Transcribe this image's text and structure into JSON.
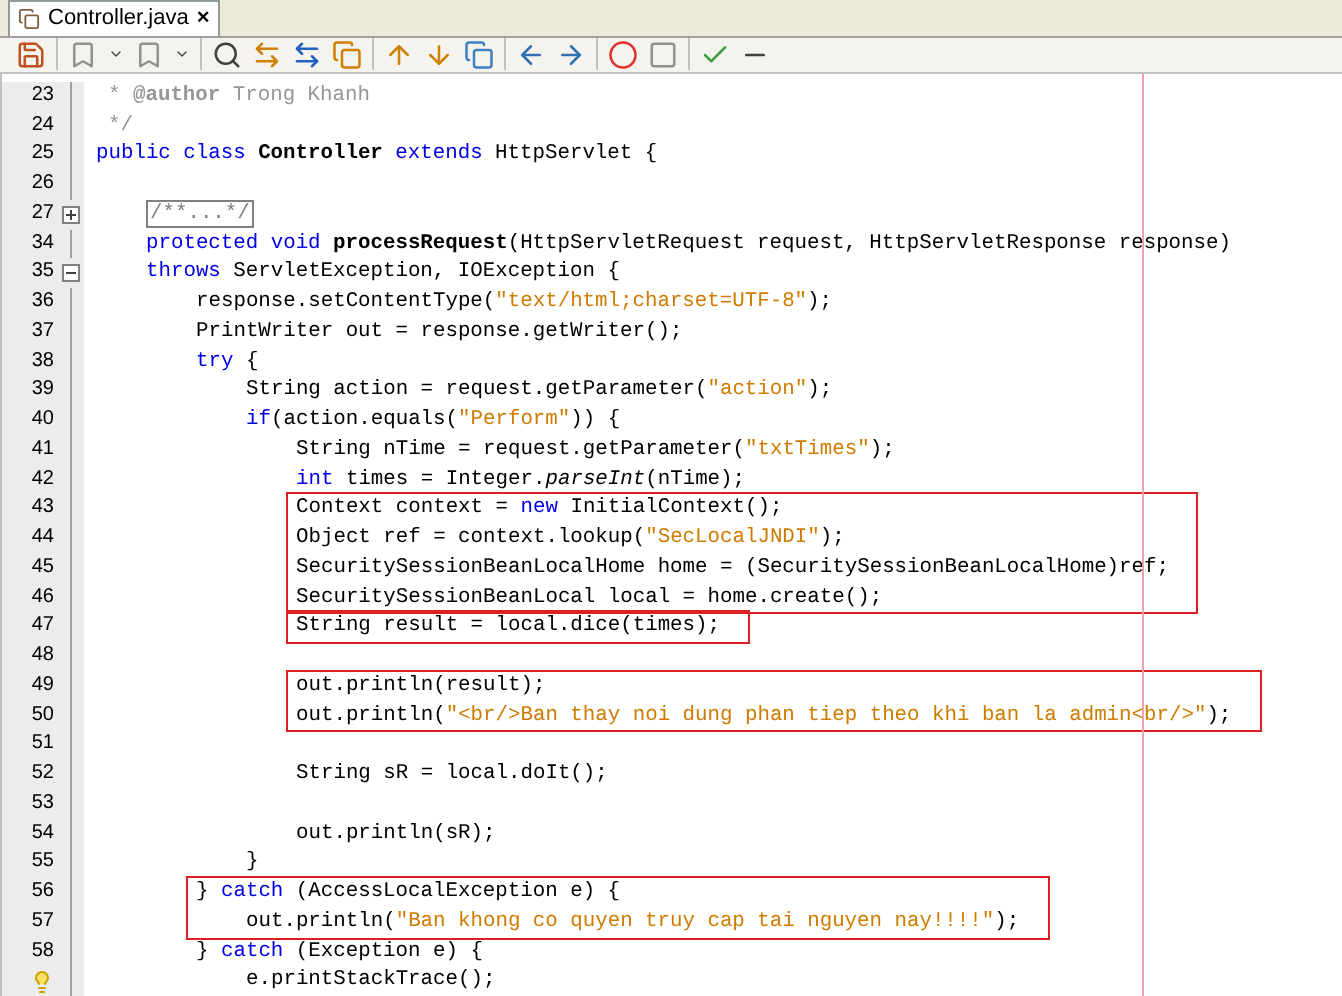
{
  "tab": {
    "label": "Controller.java",
    "close": "×",
    "selected": true
  },
  "code": [
    {
      "kind": "line",
      "number": "23",
      "tokens": [
        {
          "kind": "comment",
          "text": "* "
        },
        {
          "kind": "comment-tag",
          "text": "@author"
        },
        {
          "kind": "comment",
          "text": " Trong Khanh"
        }
      ]
    },
    {
      "kind": "line",
      "number": "24",
      "tokens": [
        {
          "kind": "comment",
          "text": "*/"
        }
      ]
    },
    {
      "kind": "line",
      "number": "25",
      "tokens": [
        {
          "kind": "keyword",
          "text": "public class "
        },
        {
          "kind": "bold",
          "text": "Controller"
        },
        {
          "kind": "keyword",
          "text": " extends "
        },
        {
          "kind": "plain",
          "text": "HttpServlet {"
        }
      ],
      "children": [
        {
          "kind": "blank",
          "number": "26"
        },
        {
          "kind": "line",
          "number": "27",
          "expanded": false,
          "tokens": [
            {
              "kind": "folded",
              "text": "/**...*/"
            }
          ]
        },
        {
          "kind": "line",
          "number": "34",
          "tokens": [
            {
              "kind": "keyword",
              "text": "protected void "
            },
            {
              "kind": "bold",
              "text": "processRequest"
            },
            {
              "kind": "plain",
              "text": "(HttpServletRequest request, HttpServletResponse response)"
            }
          ]
        },
        {
          "kind": "line",
          "number": "35",
          "expanded": true,
          "tokens": [
            {
              "kind": "keyword",
              "text": "throws "
            },
            {
              "kind": "plain",
              "text": "ServletException, IOException {"
            }
          ],
          "children": [
            {
              "kind": "line",
              "number": "36",
              "tokens": [
                {
                  "kind": "plain",
                  "text": "response.setContentType("
                },
                {
                  "kind": "string",
                  "text": "\"text/html;charset=UTF-8\""
                },
                {
                  "kind": "plain",
                  "text": ");"
                }
              ]
            },
            {
              "kind": "line",
              "number": "37",
              "tokens": [
                {
                  "kind": "plain",
                  "text": "PrintWriter out = response.getWriter();"
                }
              ]
            },
            {
              "kind": "line",
              "number": "38",
              "tokens": [
                {
                  "kind": "keyword",
                  "text": "try "
                },
                {
                  "kind": "plain",
                  "text": "{"
                }
              ],
              "children": [
                {
                  "kind": "line",
                  "number": "39",
                  "tokens": [
                    {
                      "kind": "plain",
                      "text": "String action = request.getParameter("
                    },
                    {
                      "kind": "string",
                      "text": "\"action\""
                    },
                    {
                      "kind": "plain",
                      "text": ");"
                    }
                  ]
                },
                {
                  "kind": "line",
                  "number": "40",
                  "tokens": [
                    {
                      "kind": "keyword",
                      "text": "if"
                    },
                    {
                      "kind": "plain",
                      "text": "(action.equals("
                    },
                    {
                      "kind": "string",
                      "text": "\"Perform\""
                    },
                    {
                      "kind": "plain",
                      "text": ")) {"
                    }
                  ],
                  "children": [
                    {
                      "kind": "line",
                      "number": "41",
                      "tokens": [
                        {
                          "kind": "plain",
                          "text": "String nTime = request.getParameter("
                        },
                        {
                          "kind": "string",
                          "text": "\"txtTimes\""
                        },
                        {
                          "kind": "plain",
                          "text": ");"
                        }
                      ]
                    },
                    {
                      "kind": "line",
                      "number": "42",
                      "tokens": [
                        {
                          "kind": "keyword",
                          "text": "int "
                        },
                        {
                          "kind": "plain",
                          "text": "times = Integer."
                        },
                        {
                          "kind": "italic",
                          "text": "parseInt"
                        },
                        {
                          "kind": "plain",
                          "text": "(nTime);"
                        }
                      ]
                    },
                    {
                      "kind": "box",
                      "lines": [
                        {
                          "kind": "line",
                          "number": "43",
                          "tokens": [
                            {
                              "kind": "plain",
                              "text": "Context context = "
                            },
                            {
                              "kind": "keyword",
                              "text": "new "
                            },
                            {
                              "kind": "plain",
                              "text": "InitialContext();"
                            }
                          ]
                        },
                        {
                          "kind": "line",
                          "number": "44",
                          "tokens": [
                            {
                              "kind": "plain",
                              "text": "Object ref = context.lookup("
                            },
                            {
                              "kind": "string",
                              "text": "\"SecLocalJNDI\""
                            },
                            {
                              "kind": "plain",
                              "text": ");"
                            }
                          ]
                        },
                        {
                          "kind": "line",
                          "number": "45",
                          "tokens": [
                            {
                              "kind": "plain",
                              "text": "SecuritySessionBeanLocalHome home = (SecuritySessionBeanLocalHome)ref;"
                            }
                          ]
                        },
                        {
                          "kind": "line",
                          "number": "46",
                          "tokens": [
                            {
                              "kind": "plain",
                              "text": "SecuritySessionBeanLocal local = home.create();"
                            }
                          ]
                        }
                      ]
                    },
                    {
                      "kind": "box",
                      "lines": [
                        {
                          "kind": "line",
                          "number": "47",
                          "tokens": [
                            {
                              "kind": "plain",
                              "text": "String result = local.dice(times);"
                            }
                          ]
                        }
                      ]
                    },
                    {
                      "kind": "blank",
                      "number": "48"
                    },
                    {
                      "kind": "box",
                      "lines": [
                        {
                          "kind": "line",
                          "number": "49",
                          "tokens": [
                            {
                              "kind": "plain",
                              "text": "out.println(result);"
                            }
                          ]
                        },
                        {
                          "kind": "line",
                          "number": "50",
                          "tokens": [
                            {
                              "kind": "plain",
                              "text": "out.println("
                            },
                            {
                              "kind": "string",
                              "text": "\"<br/>Ban thay noi dung phan tiep theo khi ban la admin<br/>\""
                            },
                            {
                              "kind": "plain",
                              "text": ");"
                            }
                          ]
                        }
                      ]
                    },
                    {
                      "kind": "blank",
                      "number": "51"
                    },
                    {
                      "kind": "line",
                      "number": "52",
                      "tokens": [
                        {
                          "kind": "plain",
                          "text": "String sR = local.doIt();"
                        }
                      ]
                    },
                    {
                      "kind": "blank",
                      "number": "53"
                    },
                    {
                      "kind": "line",
                      "number": "54",
                      "tokens": [
                        {
                          "kind": "plain",
                          "text": "out.println(sR);"
                        }
                      ]
                    }
                  ]
                },
                {
                  "kind": "line",
                  "number": "55",
                  "tokens": [
                    {
                      "kind": "plain",
                      "text": "}"
                    }
                  ]
                }
              ]
            },
            {
              "kind": "box",
              "lines": [
                {
                  "kind": "line",
                  "number": "56",
                  "tokens": [
                    {
                      "kind": "plain",
                      "text": "} "
                    },
                    {
                      "kind": "keyword",
                      "text": "catch "
                    },
                    {
                      "kind": "plain",
                      "text": "(AccessLocalException e) {"
                    }
                  ],
                  "children": [
                    {
                      "kind": "line",
                      "number": "57",
                      "tokens": [
                        {
                          "kind": "plain",
                          "text": "out.println("
                        },
                        {
                          "kind": "string",
                          "text": "\"Ban khong co quyen truy cap tai nguyen nay!!!!\""
                        },
                        {
                          "kind": "plain",
                          "text": ");"
                        }
                      ]
                    }
                  ]
                }
              ]
            },
            {
              "kind": "line",
              "number": "58",
              "tokens": [
                {
                  "kind": "plain",
                  "text": "} "
                },
                {
                  "kind": "keyword",
                  "text": "catch "
                },
                {
                  "kind": "plain",
                  "text": "(Exception e) {"
                }
              ],
              "children": [
                {
                  "kind": "line",
                  "hint": true,
                  "tokens": [
                    {
                      "kind": "plain",
                      "text": "e.printStackTrace();"
                    }
                  ]
                }
              ]
            }
          ]
        }
      ]
    }
  ]
}
